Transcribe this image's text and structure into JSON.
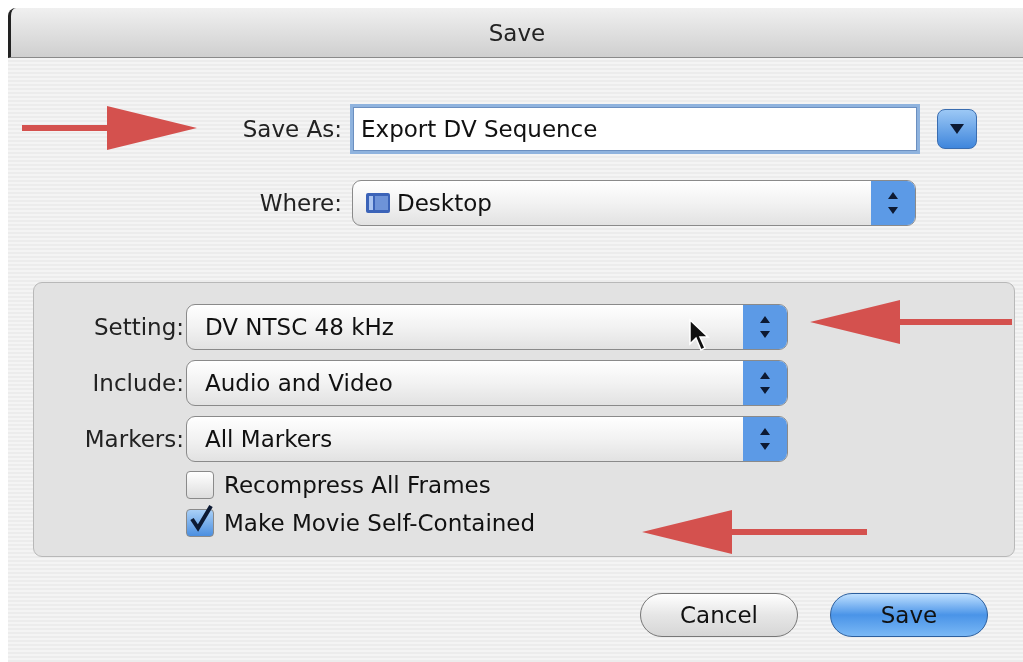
{
  "window": {
    "title": "Save"
  },
  "save_as": {
    "label": "Save As:",
    "value": "Export DV Sequence",
    "expanded": false
  },
  "where": {
    "label": "Where:",
    "value": "Desktop"
  },
  "options": {
    "popups": [
      {
        "label": "Setting:",
        "value": "DV NTSC 48 kHz"
      },
      {
        "label": "Include:",
        "value": "Audio and Video"
      },
      {
        "label": "Markers:",
        "value": "All Markers"
      }
    ],
    "checkboxes": [
      {
        "label": "Recompress All Frames",
        "checked": false
      },
      {
        "label": "Make Movie Self-Contained",
        "checked": true
      }
    ]
  },
  "buttons": [
    {
      "label": "Cancel",
      "default": false
    },
    {
      "label": "Save",
      "default": true
    }
  ]
}
